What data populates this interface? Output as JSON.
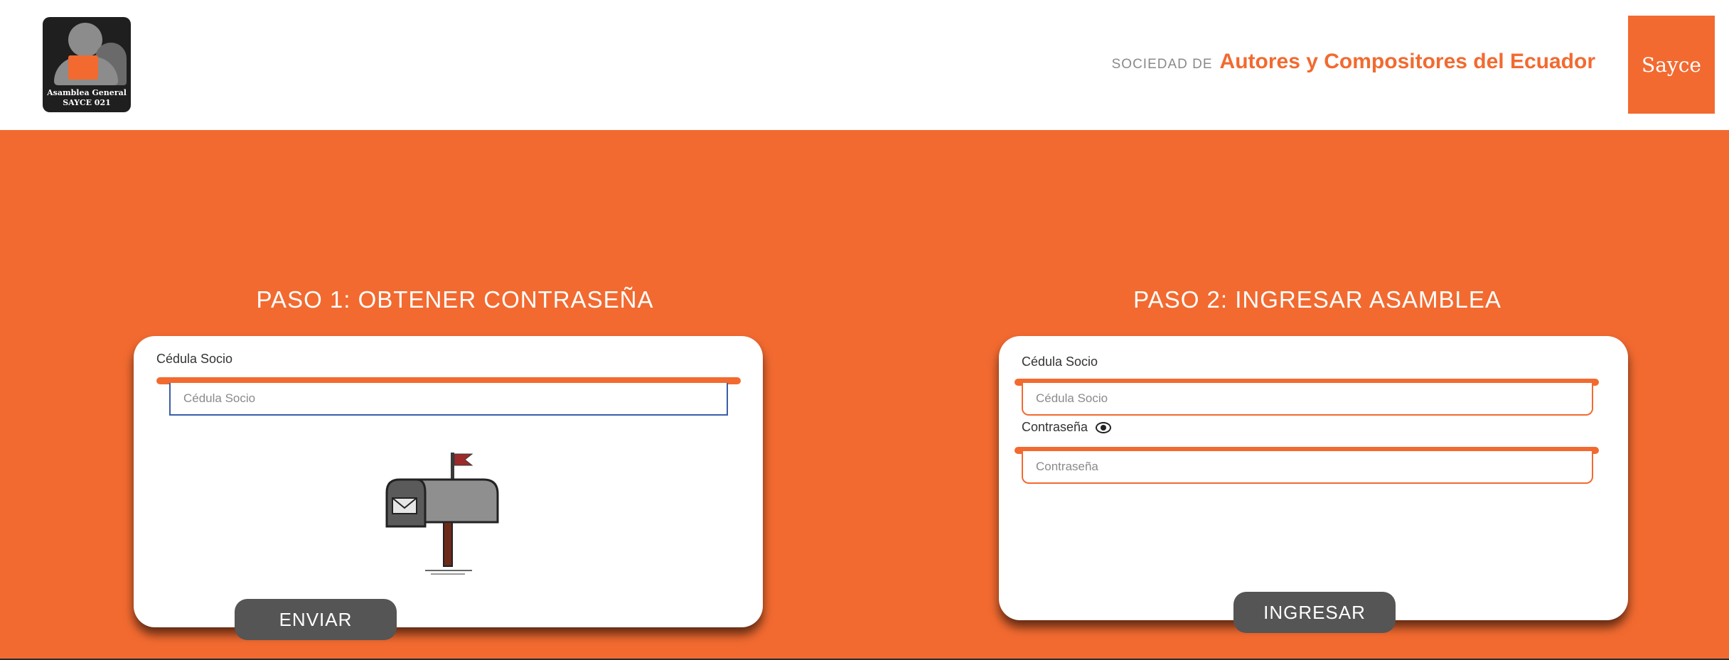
{
  "header": {
    "logo_line1": "Asamblea General",
    "logo_line2": "SAYCE 021",
    "brand_prefix": "SOCIEDAD DE",
    "brand_name": "Autores y Compositores del Ecuador",
    "sayce_badge": "Sayce"
  },
  "step1": {
    "title": "PASO 1: OBTENER CONTRASEÑA",
    "id_label": "Cédula Socio",
    "id_placeholder": "Cédula Socio",
    "button_label": "ENVIAR"
  },
  "step2": {
    "title": "PASO 2: INGRESAR ASAMBLEA",
    "id_label": "Cédula Socio",
    "id_placeholder": "Cédula Socio",
    "password_label": "Contraseña",
    "password_placeholder": "Contraseña",
    "button_label": "INGRESAR"
  },
  "colors": {
    "accent": "#f26a30",
    "button": "#555555"
  },
  "icons": {
    "logo": "assembly-logo",
    "password_toggle": "eye-icon",
    "illustration": "mailbox-icon"
  }
}
